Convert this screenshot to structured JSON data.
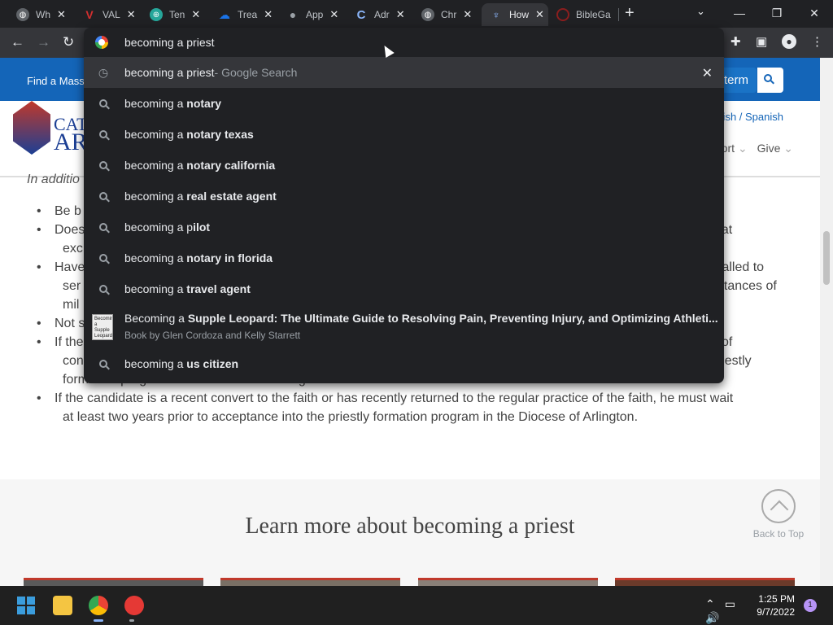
{
  "tabs": [
    {
      "title": "Wh",
      "favicon_color": "#e8eaed"
    },
    {
      "title": "VAL",
      "favicon_color": "#d32f2f"
    },
    {
      "title": "Ten",
      "favicon_color": "#26a69a"
    },
    {
      "title": "Trea",
      "favicon_color": "#1a73e8"
    },
    {
      "title": "App",
      "favicon_color": "#9aa0a6"
    },
    {
      "title": "Adr",
      "favicon_color": "#8ab4f8"
    },
    {
      "title": "Chr",
      "favicon_color": "#9aa0a6"
    },
    {
      "title": "How",
      "favicon_color": "#5c6bc0"
    },
    {
      "title": "BibleGa",
      "favicon_color": "#8b1e1e"
    }
  ],
  "omnibox": {
    "query": "becoming a priest",
    "highlighted": {
      "typed": "becoming a priest",
      "suffix": " - Google Search"
    },
    "suggestions": [
      {
        "plain": "becoming a ",
        "bold": "notary"
      },
      {
        "plain": "becoming a ",
        "bold": "notary texas"
      },
      {
        "plain": "becoming a ",
        "bold": "notary california"
      },
      {
        "plain": "becoming a ",
        "bold": "real estate agent"
      },
      {
        "plain": "becoming a p",
        "bold": "ilot"
      },
      {
        "plain": "becoming a ",
        "bold": "notary in florida"
      },
      {
        "plain": "becoming a ",
        "bold": "travel agent"
      }
    ],
    "book": {
      "plain": "Becoming a ",
      "bold": "Supple Leopard: The Ultimate Guide to Resolving Pain, Preventing Injury, and Optimizing Athleti...",
      "subtitle": "Book by Glen Cordoza and Kelly Starrett",
      "thumb_text": "Becoming a Supple Leopard"
    },
    "last": {
      "plain": "becoming a ",
      "bold": "us citizen"
    }
  },
  "site": {
    "find_mass": "Find a Mass",
    "search_term": "term",
    "logo_line1": "CATI",
    "logo_line2": "AR",
    "lang": "lish / Spanish",
    "nav_support": "port",
    "nav_give": "Give",
    "intro": "In additio",
    "bullets": [
      {
        "lead": "Be b",
        "tail": ""
      },
      {
        "lead": "Does",
        "tail": "nat",
        "cont": "exc"
      },
      {
        "lead": "Have",
        "tail": "s called to",
        "cont": "ser",
        "cont_tail": "nstances of",
        "cont2": "mil"
      },
      {
        "lead": "Not s",
        "tail": ""
      },
      {
        "lead": "If the",
        "tail": "of",
        "cont": "con",
        "cont_tail": "priestly",
        "cont2": "formation program in the Diocese of Arlington."
      },
      {
        "lead": "If the candidate is a recent convert to the faith or has recently returned to the regular practice of the faith, he must wait",
        "cont": "at least two years prior to acceptance into the priestly formation program in the Diocese of Arlington."
      }
    ],
    "learn_more": "Learn more about becoming a priest",
    "back_to_top": "Back to Top"
  },
  "taskbar": {
    "time": "1:25 PM",
    "date": "9/7/2022",
    "notifications": "1"
  }
}
